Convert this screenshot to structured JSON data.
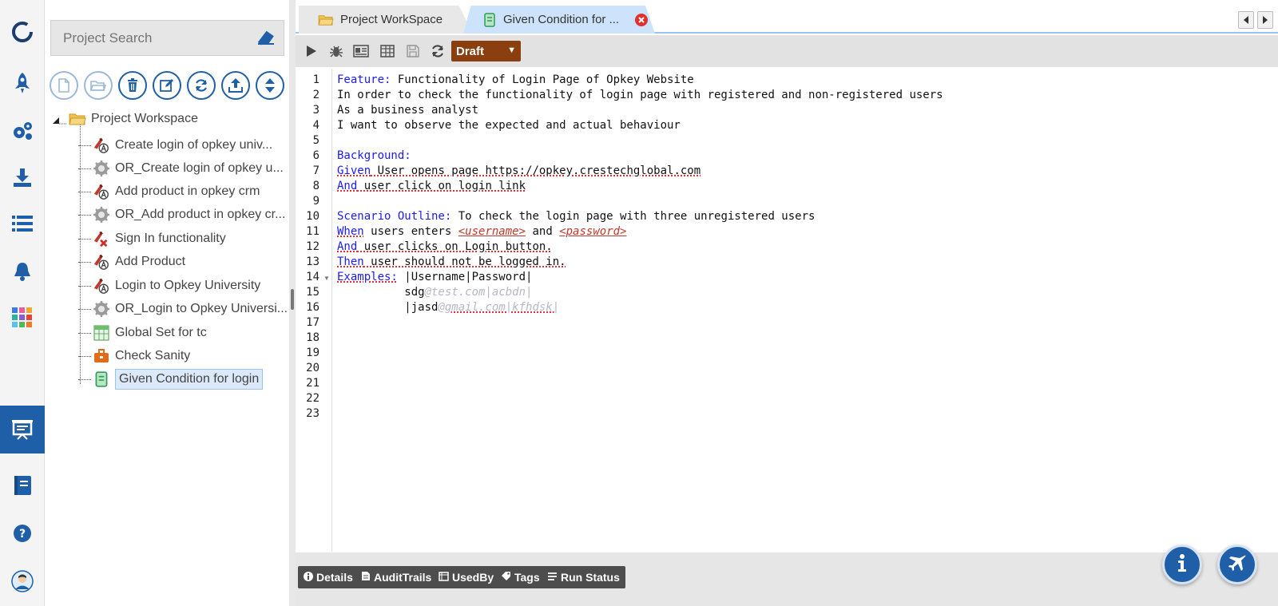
{
  "colors": {
    "accent": "#1f5fa8",
    "draft": "#8b3f0f",
    "keyword": "#1a1aff"
  },
  "rail": {
    "items": [
      {
        "icon": "opkey-logo-icon"
      },
      {
        "icon": "rocket-icon"
      },
      {
        "icon": "gears-icon"
      },
      {
        "icon": "download-icon"
      },
      {
        "icon": "list-icon"
      },
      {
        "icon": "bell-icon"
      },
      {
        "icon": "apps-grid-icon"
      },
      {
        "icon": "presentation-icon",
        "active": true
      },
      {
        "icon": "book-icon"
      },
      {
        "icon": "help-icon"
      },
      {
        "icon": "user-avatar-icon"
      }
    ]
  },
  "search": {
    "placeholder": "Project Search"
  },
  "tree": {
    "root": "Project Workspace",
    "items": [
      {
        "label": "Create login of opkey univ...",
        "icon": "test-case-icon"
      },
      {
        "label": "OR_Create login of opkey u...",
        "icon": "object-repo-icon"
      },
      {
        "label": "Add product in opkey crm",
        "icon": "test-case-icon"
      },
      {
        "label": "OR_Add product in opkey cr...",
        "icon": "object-repo-icon"
      },
      {
        "label": "Sign In functionality",
        "icon": "test-case-red-icon"
      },
      {
        "label": "Add Product",
        "icon": "test-case-icon"
      },
      {
        "label": "Login to Opkey University",
        "icon": "test-case-icon"
      },
      {
        "label": "OR_Login to Opkey Universi...",
        "icon": "object-repo-icon"
      },
      {
        "label": "Global Set for tc",
        "icon": "data-sheet-icon"
      },
      {
        "label": "Check Sanity",
        "icon": "suite-icon"
      },
      {
        "label": "Given Condition for login",
        "icon": "scroll-icon",
        "selected": true
      }
    ]
  },
  "tabs": [
    {
      "label": "Project WorkSpace"
    },
    {
      "label": "Given Condition for ..."
    }
  ],
  "toolbar": {
    "status": "Draft"
  },
  "editor": {
    "line_numbers": [
      "1",
      "2",
      "3",
      "4",
      "5",
      "6",
      "7",
      "8",
      "9",
      "10",
      "11",
      "12",
      "13",
      "14",
      "15",
      "16",
      "17",
      "18",
      "19",
      "20",
      "21",
      "22",
      "23"
    ],
    "l1_kw": "Feature:",
    "l1": " Functionality of Login Page of Opkey Website",
    "l2": "In order to check the functionality of login page with registered and non-registered users",
    "l3": "As a business analyst",
    "l4": "I want to observe the expected and actual behaviour",
    "l6_kw": "Background:",
    "l7_kw": "Given",
    "l7": " User opens page https://opkey.crestechglobal.com",
    "l8_kw": "And",
    "l8": " user click on login link",
    "l10_kw": "Scenario Outline:",
    "l10": " To check the login page with three unregistered users",
    "l11_kw": "When",
    "l11a": " users enters ",
    "l11_ph1": "<username>",
    "l11b": " and ",
    "l11_ph2": "<password>",
    "l12_kw": "And",
    "l12": " user clicks on Login button.",
    "l13_kw": "Then",
    "l13": " user should not be logged in.",
    "l14_kw": "Examples:",
    "l14": " |Username|Password|",
    "l15a": "          sdg",
    "l15b": "@test.com|acbdn|",
    "l16a": "          |jasd",
    "l16b": "@gmail.com|kfhdsk|"
  },
  "bottom_tabs": [
    {
      "label": "Details",
      "icon": "info-icon"
    },
    {
      "label": "AuditTrails",
      "icon": "audit-icon"
    },
    {
      "label": "UsedBy",
      "icon": "usedby-icon"
    },
    {
      "label": "Tags",
      "icon": "tag-icon"
    },
    {
      "label": "Run Status",
      "icon": "run-status-icon"
    }
  ],
  "fabs": [
    {
      "icon": "info-icon"
    },
    {
      "icon": "airplane-icon"
    }
  ]
}
